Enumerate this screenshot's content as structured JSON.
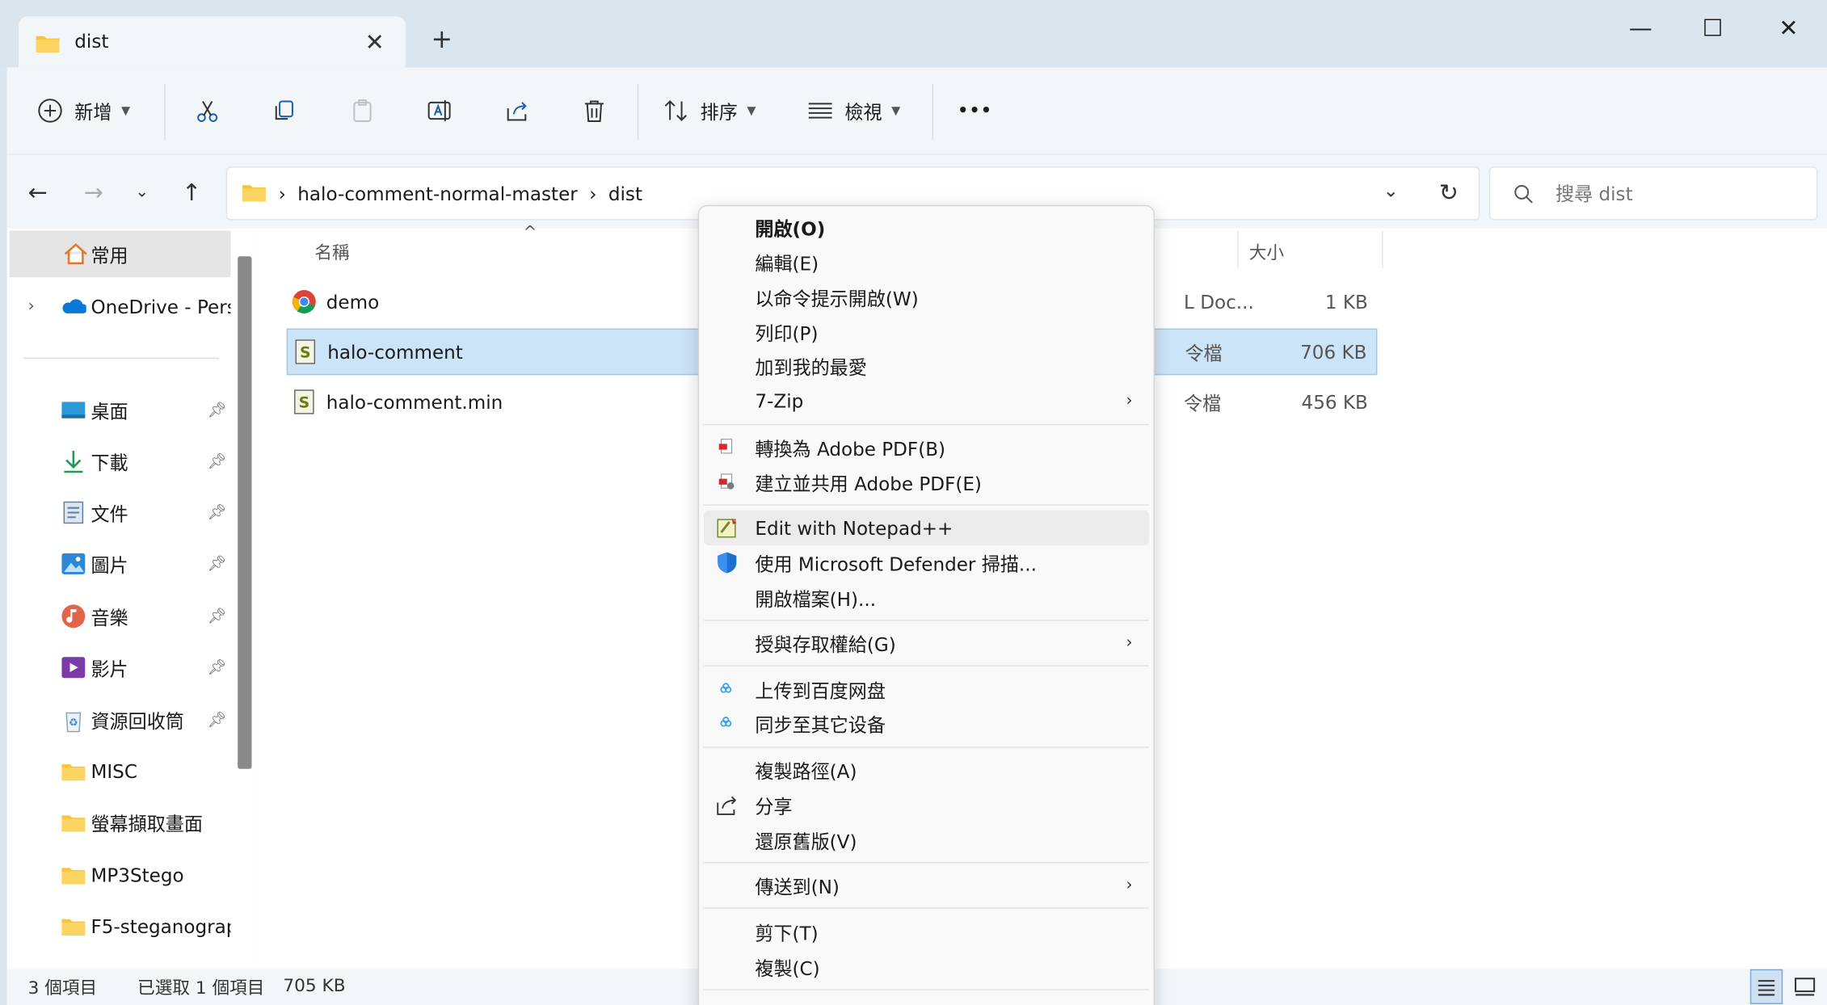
{
  "window": {
    "tab_title": "dist",
    "new_tab": "+",
    "minimize": "—",
    "maximize": "☐",
    "close": "✕"
  },
  "toolbar": {
    "new_label": "新增",
    "sort_label": "排序",
    "view_label": "檢視",
    "more": "•••"
  },
  "address": {
    "crumbs": [
      "halo-comment-normal-master",
      "dist"
    ],
    "search_placeholder": "搜尋 dist"
  },
  "sidebar": {
    "items": [
      {
        "label": "常用",
        "icon": "home-icon",
        "pinned": false
      },
      {
        "label": "OneDrive - Pers",
        "icon": "onedrive-cloud-icon",
        "pinned": false
      },
      {
        "label": "桌面",
        "icon": "desktop-icon",
        "pinned": true
      },
      {
        "label": "下載",
        "icon": "download-icon",
        "pinned": true
      },
      {
        "label": "文件",
        "icon": "document-icon",
        "pinned": true
      },
      {
        "label": "圖片",
        "icon": "pictures-icon",
        "pinned": true
      },
      {
        "label": "音樂",
        "icon": "music-icon",
        "pinned": true
      },
      {
        "label": "影片",
        "icon": "video-icon",
        "pinned": true
      },
      {
        "label": "資源回收筒",
        "icon": "recycle-bin-icon",
        "pinned": true
      },
      {
        "label": "MISC",
        "icon": "folder-icon",
        "pinned": false
      },
      {
        "label": "螢幕擷取畫面",
        "icon": "folder-icon",
        "pinned": false
      },
      {
        "label": "MP3Stego",
        "icon": "folder-icon",
        "pinned": false
      },
      {
        "label": "F5-steganograp",
        "icon": "folder-icon",
        "pinned": false
      }
    ]
  },
  "files": {
    "columns": {
      "name": "名稱",
      "size": "大小"
    },
    "rows": [
      {
        "name": "demo",
        "type": "L Doc...",
        "size": "1 KB",
        "icon": "chrome-icon",
        "selected": false
      },
      {
        "name": "halo-comment",
        "type": "令檔",
        "size": "706 KB",
        "icon": "script-file-icon",
        "selected": true
      },
      {
        "name": "halo-comment.min",
        "type": "令檔",
        "size": "456 KB",
        "icon": "script-file-icon",
        "selected": false
      }
    ]
  },
  "status": {
    "item_count": "3 個項目",
    "selected": "已選取 1 個項目",
    "selected_size": "705 KB"
  },
  "context_menu": {
    "items": [
      {
        "label": "開啟(O)",
        "bold": true
      },
      {
        "label": "編輯(E)"
      },
      {
        "label": "以命令提示開啟(W)"
      },
      {
        "label": "列印(P)"
      },
      {
        "label": "加到我的最愛"
      },
      {
        "label": "7-Zip",
        "submenu": true
      },
      {
        "label": "轉換為 Adobe PDF(B)",
        "icon": "adobe-pdf-icon"
      },
      {
        "label": "建立並共用 Adobe PDF(E)",
        "icon": "adobe-pdf-share-icon"
      },
      {
        "label": "Edit with Notepad++",
        "icon": "notepad-plus-plus-icon",
        "hover": true
      },
      {
        "label": "使用 Microsoft Defender 掃描...",
        "icon": "defender-shield-icon"
      },
      {
        "label": "開啟檔案(H)..."
      },
      {
        "label": "授與存取權給(G)",
        "submenu": true
      },
      {
        "label": "上传到百度网盘",
        "icon": "baidu-cloud-icon"
      },
      {
        "label": "同步至其它设备",
        "icon": "baidu-cloud-icon"
      },
      {
        "label": "複製路徑(A)"
      },
      {
        "label": "分享",
        "icon": "share-icon"
      },
      {
        "label": "還原舊版(V)"
      },
      {
        "label": "傳送到(N)",
        "submenu": true
      },
      {
        "label": "剪下(T)"
      },
      {
        "label": "複製(C)"
      }
    ],
    "submenu_arrow": "›"
  },
  "colors": {
    "selection": "#cce4f7",
    "accent": "#0067c0",
    "folder": "#f8c43a"
  }
}
